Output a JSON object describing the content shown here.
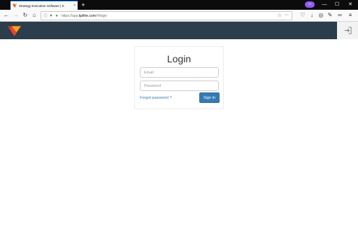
{
  "browser": {
    "tab_title": "Strategy Execution Software | K",
    "tab_close": "×",
    "new_tab": "+",
    "url_prefix": "https://app.",
    "url_domain": "kpifire.com",
    "url_path": "/#/login",
    "ext_label": "∞",
    "win_min": "—",
    "win_max": "☐",
    "win_close": "✕"
  },
  "login": {
    "title": "Login",
    "email_placeholder": "Email",
    "password_placeholder": "Password",
    "forgot_label": "Forgot password ?",
    "signin_label": "Sign In"
  },
  "colors": {
    "header_bg": "#2c3e4c",
    "link": "#337ab7",
    "button": "#337ab7"
  }
}
